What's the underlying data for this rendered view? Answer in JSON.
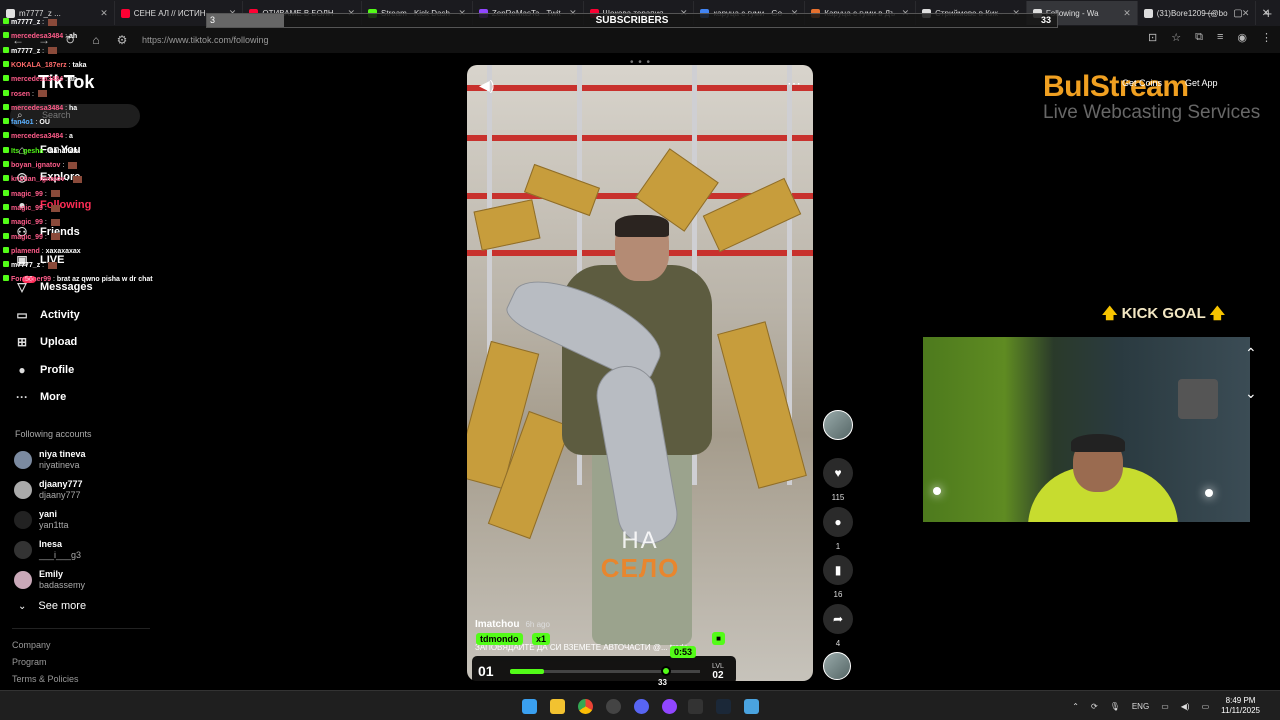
{
  "browser": {
    "tabs": [
      {
        "label": "m7777_z ...",
        "color": "#e0e0e0"
      },
      {
        "label": "СЕНЕ АЛ // ИСТИН",
        "color": "#ff0033"
      },
      {
        "label": "ОТИВАМЕ В БОЛН",
        "color": "#ff0033"
      },
      {
        "label": "Stream - Kick Dash",
        "color": "#53fc18"
      },
      {
        "label": "ZenReMasTa - Twit",
        "color": "#9146ff"
      },
      {
        "label": "Шокова терапия",
        "color": "#ff0033"
      },
      {
        "label": "каруца с гуми - Go",
        "color": "#4285f4"
      },
      {
        "label": "Каруца с гуми в Дъ",
        "color": "#e8712e"
      },
      {
        "label": "Стриймове в Кик -",
        "color": "#dddddd"
      },
      {
        "label": "Following - Wa",
        "color": "#dddddd"
      },
      {
        "label": "(31)Bore1209 (@bo",
        "color": "#dddddd"
      }
    ],
    "url": "https://www.tiktok.com/following"
  },
  "subscribers": {
    "title": "SUBSCRIBERS",
    "current": "3",
    "goal": "33",
    "progress": 0.09
  },
  "sidebar": {
    "logo": "TikTok",
    "search_placeholder": "Search",
    "nav": [
      {
        "label": "For You",
        "icon": "home-icon",
        "glyph": "⌂"
      },
      {
        "label": "Explore",
        "icon": "compass-icon",
        "glyph": "◎"
      },
      {
        "label": "Following",
        "icon": "following-icon",
        "glyph": "●"
      },
      {
        "label": "Friends",
        "icon": "friends-icon",
        "glyph": "⚇"
      },
      {
        "label": "LIVE",
        "icon": "live-icon",
        "glyph": "▣"
      },
      {
        "label": "Messages",
        "icon": "messages-icon",
        "glyph": "▽"
      },
      {
        "label": "Activity",
        "icon": "activity-icon",
        "glyph": "▭"
      },
      {
        "label": "Upload",
        "icon": "upload-icon",
        "glyph": "⊞"
      },
      {
        "label": "Profile",
        "icon": "profile-icon",
        "glyph": "●"
      },
      {
        "label": "More",
        "icon": "more-icon",
        "glyph": "···"
      }
    ],
    "messages_badge": "56",
    "following_title": "Following accounts",
    "accounts": [
      {
        "name": "niya tineva",
        "username": "niyatineva"
      },
      {
        "name": "djaany777",
        "username": "djaany777"
      },
      {
        "name": "yani",
        "username": "yan1tta"
      },
      {
        "name": "Inesa",
        "username": "___i___g3"
      },
      {
        "name": "Emily",
        "username": "badassemy"
      }
    ],
    "see_more": "See more",
    "footer": [
      "Company",
      "Program",
      "Terms & Policies"
    ]
  },
  "chat": [
    {
      "user": "m7777_z",
      "msg": "",
      "color": "#ffffff"
    },
    {
      "user": "mercedesa3484",
      "msg": "ah",
      "color": "#ff5c8a"
    },
    {
      "user": "m7777_z",
      "msg": "",
      "color": "#ffffff"
    },
    {
      "user": "KOKALA_187erz",
      "msg": "taka",
      "color": "#ff6b6b"
    },
    {
      "user": "mercedesa3484",
      "msg": "ah",
      "color": "#ff5c8a"
    },
    {
      "user": "rosen",
      "msg": "",
      "color": "#ff5c8a"
    },
    {
      "user": "mercedesa3484",
      "msg": "ha",
      "color": "#ff5c8a"
    },
    {
      "user": "fan4o1",
      "msg": "OU",
      "color": "#5ab0ff"
    },
    {
      "user": "mercedesa3484",
      "msg": "a",
      "color": "#ff5c8a"
    },
    {
      "user": "Its_gesha",
      "msg": "hahahah",
      "color": "#53fc18"
    },
    {
      "user": "boyan_ignatov",
      "msg": "",
      "color": "#ff5c8a"
    },
    {
      "user": "kristian_ignatov",
      "msg": "",
      "color": "#ff5c8a"
    },
    {
      "user": "magic_99",
      "msg": "",
      "color": "#ff5c8a"
    },
    {
      "user": "magic_99",
      "msg": "",
      "color": "#ff5c8a"
    },
    {
      "user": "magic_99",
      "msg": "",
      "color": "#ff5c8a"
    },
    {
      "user": "magic_99",
      "msg": "",
      "color": "#ff5c8a"
    },
    {
      "user": "plamend",
      "msg": "xaxaxaxax",
      "color": "#ff5c8a"
    },
    {
      "user": "m7777_z",
      "msg": "",
      "color": "#ffffff"
    },
    {
      "user": "Foreigner99",
      "msg": "brat az qwno pisha w dr chat",
      "color": "#ff5c8a"
    }
  ],
  "video": {
    "caption_top": "НА",
    "caption_bottom": "СЕЛО",
    "author": "Imatchou",
    "time": "6h ago",
    "description": "ЗАПОВЯДАЙТЕ ДА СИ ВЗЕМЕТЕ АВТОЧАСТИ @... trade",
    "likes": "115",
    "comments": "1",
    "saves": "16",
    "shares": "4"
  },
  "overlay": {
    "brand": "BulStream",
    "brand_sub": "Live Webcasting Services",
    "get_coins": "Get Coins",
    "get_app": "Get App",
    "kick_goal": "KICK GOAL",
    "tip_user": "tdmondo",
    "tip_mult": "x1",
    "timer": "0:53",
    "level_num": "01",
    "level_label": "LVL",
    "level_value": "02",
    "below_value": "33",
    "bar_progress": 0.18
  },
  "taskbar": {
    "lang": "ENG",
    "time": "8:49 PM",
    "date": "11/11/2025"
  }
}
